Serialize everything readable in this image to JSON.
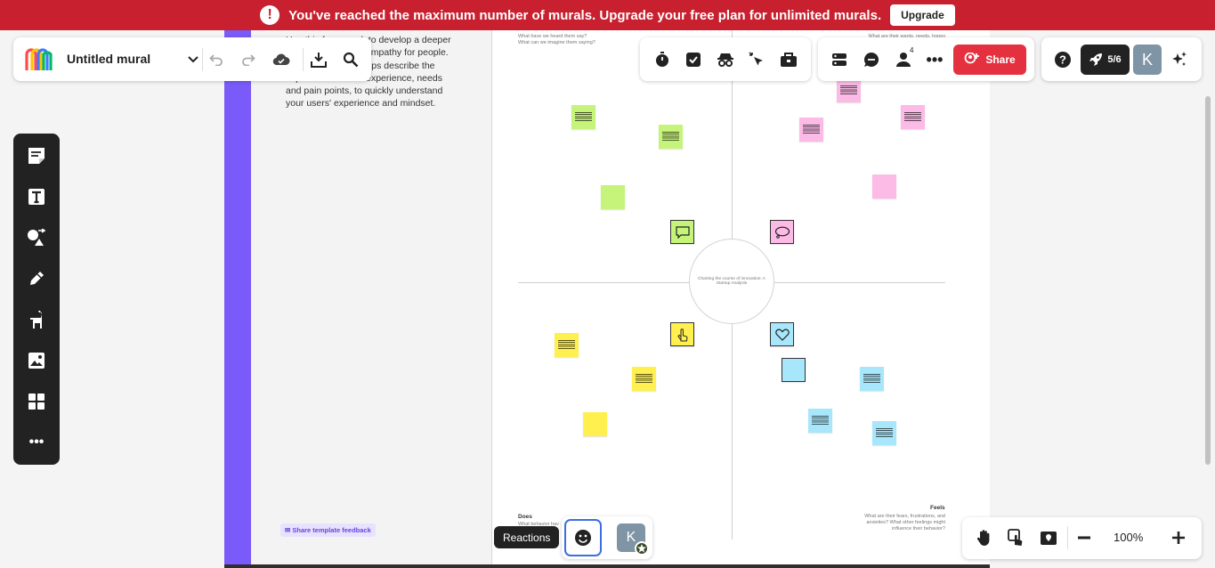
{
  "banner": {
    "message": "You've reached the maximum number of murals. Upgrade your free plan for unlimited murals.",
    "upgrade_label": "Upgrade",
    "color": "#c8202f"
  },
  "header": {
    "title": "Untitled mural"
  },
  "toolbar": {
    "share_label": "Share",
    "launch_count": "5/6",
    "avatar_initial": "K",
    "notification_count": "4"
  },
  "left_panel": {
    "description": "Use this framework to develop a deeper understanding and empathy for people. An empathy map helps describe the aspects of a user's experience, needs and pain points, to quickly understand your users' experience and mindset.",
    "feedback_label": "Share template feedback"
  },
  "canvas": {
    "center_label": "Charting the course of innovation: A Startup Analysis",
    "says_hint": "What have we heard them say?\nWhat can we imagine them saying?",
    "thinks_hint": "What are their wants, needs, hopes",
    "does_label": "Does",
    "does_hint": "What behavior hav",
    "feels_label": "Feels",
    "feels_hint": "What are their fears, frustrations, and anxieties? What other feelings might influence their behavior?"
  },
  "bottom": {
    "reactions_label": "Reactions",
    "avatar_initial": "K",
    "zoom": "100%"
  },
  "colors": {
    "accent": "#7a5af8",
    "share": "#e5303f",
    "green_note": "#c6f47b",
    "pink_note": "#fbbbe6",
    "yellow_note": "#fff04f",
    "blue_note": "#a8e7fb"
  }
}
